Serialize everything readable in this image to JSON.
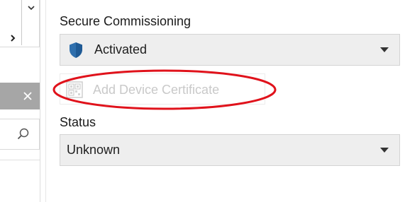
{
  "secure_commissioning": {
    "label": "Secure Commissioning",
    "selected_value": "Activated",
    "icon": "shield-icon"
  },
  "add_device_certificate": {
    "label": "Add Device Certificate",
    "enabled": false,
    "icon": "certificate-icon"
  },
  "status": {
    "label": "Status",
    "selected_value": "Unknown"
  },
  "colors": {
    "shield": "#2f6fad",
    "highlight_ellipse": "#e0121b",
    "combo_background": "#eeeeee",
    "disabled_text": "#c9c9c9"
  }
}
